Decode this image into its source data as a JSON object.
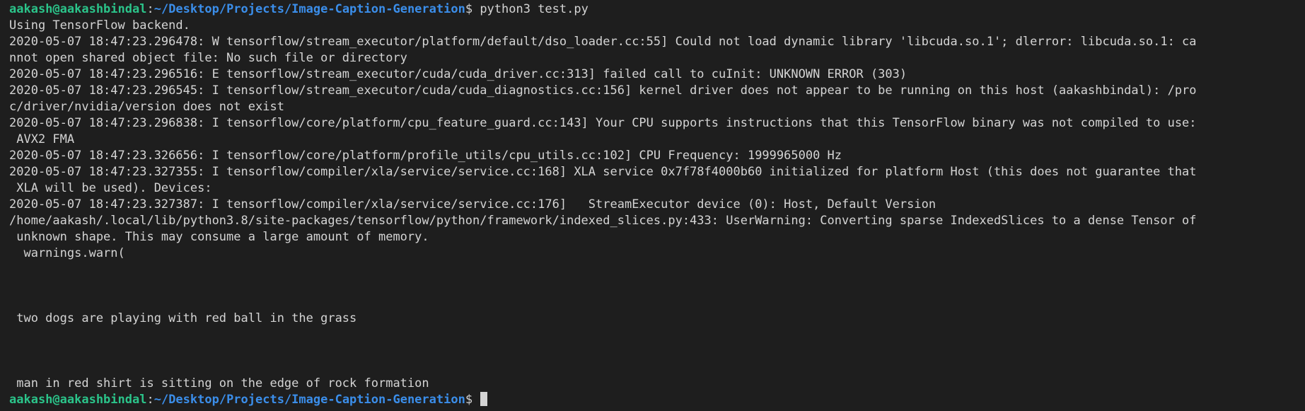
{
  "colors": {
    "background": "#1e1e1e",
    "text": "#d4d4d4",
    "user_host": "#2bc48a",
    "path": "#3b8eea"
  },
  "prompt": {
    "user_host": "aakash@aakashbindal",
    "path": "~/Desktop/Projects/Image-Caption-Generation",
    "symbol": "$ "
  },
  "command": "python3 test.py",
  "output_lines": [
    "Using TensorFlow backend.",
    "2020-05-07 18:47:23.296478: W tensorflow/stream_executor/platform/default/dso_loader.cc:55] Could not load dynamic library 'libcuda.so.1'; dlerror: libcuda.so.1: ca",
    "nnot open shared object file: No such file or directory",
    "2020-05-07 18:47:23.296516: E tensorflow/stream_executor/cuda/cuda_driver.cc:313] failed call to cuInit: UNKNOWN ERROR (303)",
    "2020-05-07 18:47:23.296545: I tensorflow/stream_executor/cuda/cuda_diagnostics.cc:156] kernel driver does not appear to be running on this host (aakashbindal): /pro",
    "c/driver/nvidia/version does not exist",
    "2020-05-07 18:47:23.296838: I tensorflow/core/platform/cpu_feature_guard.cc:143] Your CPU supports instructions that this TensorFlow binary was not compiled to use:",
    " AVX2 FMA",
    "2020-05-07 18:47:23.326656: I tensorflow/core/platform/profile_utils/cpu_utils.cc:102] CPU Frequency: 1999965000 Hz",
    "2020-05-07 18:47:23.327355: I tensorflow/compiler/xla/service/service.cc:168] XLA service 0x7f78f4000b60 initialized for platform Host (this does not guarantee that",
    " XLA will be used). Devices:",
    "2020-05-07 18:47:23.327387: I tensorflow/compiler/xla/service/service.cc:176]   StreamExecutor device (0): Host, Default Version",
    "/home/aakash/.local/lib/python3.8/site-packages/tensorflow/python/framework/indexed_slices.py:433: UserWarning: Converting sparse IndexedSlices to a dense Tensor of",
    " unknown shape. This may consume a large amount of memory.",
    "  warnings.warn(",
    "",
    "",
    "",
    " two dogs are playing with red ball in the grass",
    "",
    "",
    "",
    " man in red shirt is sitting on the edge of rock formation"
  ]
}
